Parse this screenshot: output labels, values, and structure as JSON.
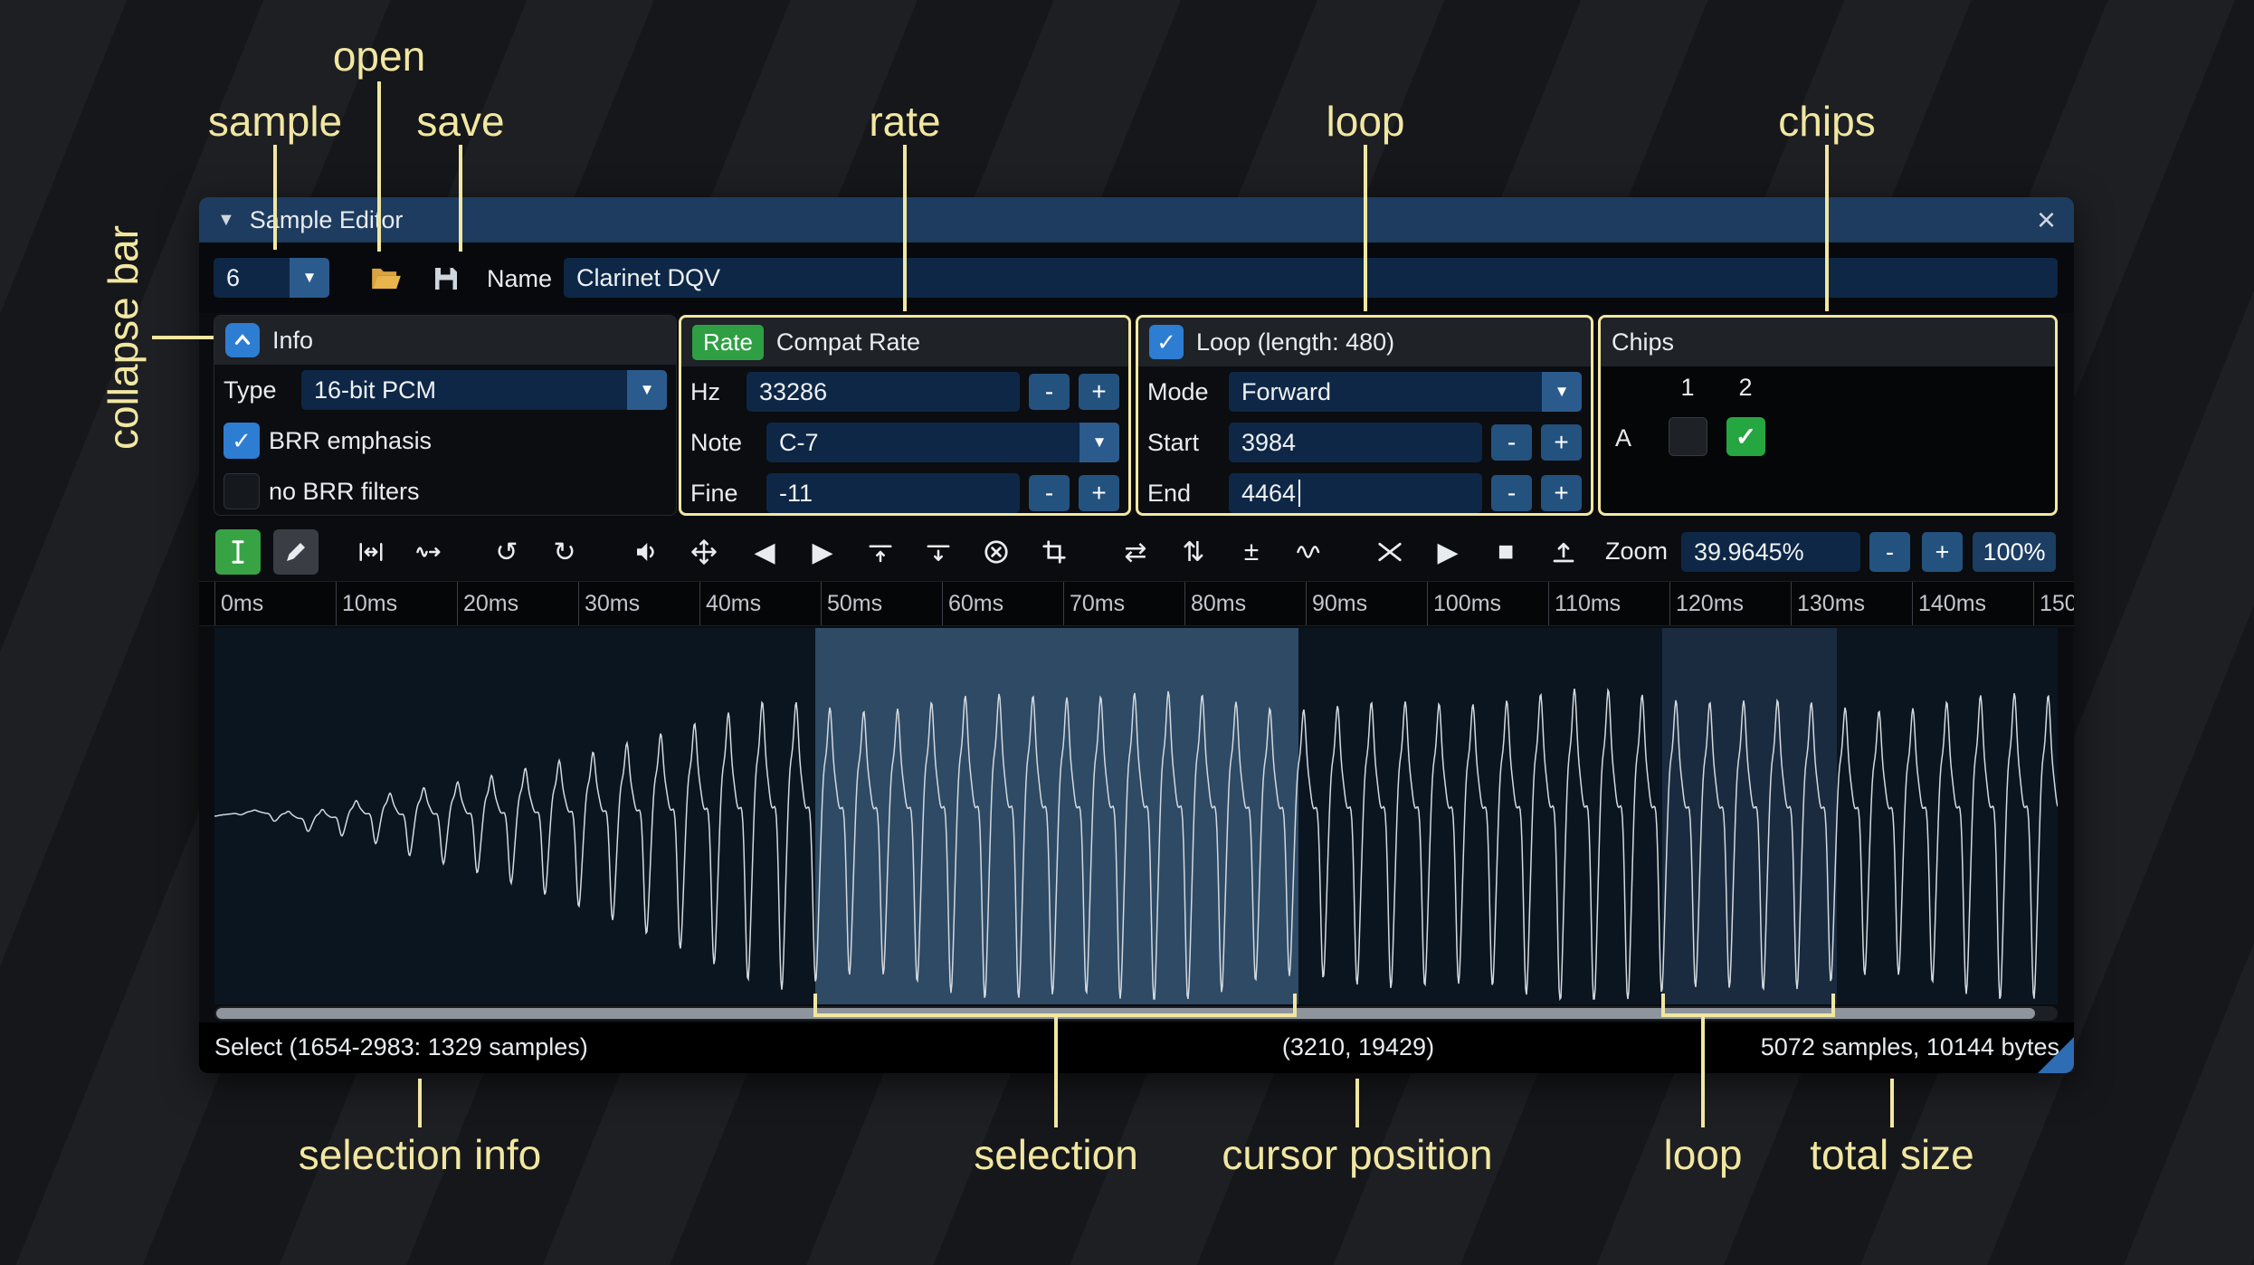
{
  "annotations": {
    "open": "open",
    "sample": "sample",
    "save": "save",
    "rate": "rate",
    "loop_top": "loop",
    "chips": "chips",
    "collapse_bar": "collapse bar",
    "selection_info": "selection info",
    "selection": "selection",
    "cursor_position": "cursor position",
    "loop_bottom": "loop",
    "total_size": "total size",
    "color": "#f1e7a1"
  },
  "titlebar": {
    "title": "Sample Editor"
  },
  "controls": {
    "sample_value": "6",
    "name_label": "Name",
    "name_value": "Clarinet DQV"
  },
  "info": {
    "header": "Info",
    "type_label": "Type",
    "type_value": "16-bit PCM",
    "brr_emphasis_label": "BRR emphasis",
    "no_brr_filters_label": "no BRR filters"
  },
  "rate": {
    "badge": "Rate",
    "header": "Compat Rate",
    "hz_label": "Hz",
    "hz_value": "33286",
    "note_label": "Note",
    "note_value": "C-7",
    "fine_label": "Fine",
    "fine_value": "-11"
  },
  "loop": {
    "header": "Loop (length: 480)",
    "mode_label": "Mode",
    "mode_value": "Forward",
    "start_label": "Start",
    "start_value": "3984",
    "end_label": "End",
    "end_value": "4464"
  },
  "chips": {
    "header": "Chips",
    "col_1": "1",
    "col_2": "2",
    "row_a": "A"
  },
  "toolbar": {
    "zoom_label": "Zoom",
    "zoom_value": "39.9645%",
    "zoom_out": "-",
    "zoom_in": "+",
    "zoom_reset": "100%"
  },
  "stepper": {
    "minus": "-",
    "plus": "+"
  },
  "icons": {
    "collapse_triangle": "▼",
    "close": "×",
    "dropdown": "▼",
    "checkbox_check": "✓",
    "undo": "↺",
    "redo": "↻",
    "fade_in": "◀",
    "fade_out": "▶",
    "reverse": "⇄",
    "invert": "⇅",
    "sign": "±",
    "preview": "▶",
    "stop": "■"
  },
  "ruler": [
    "0ms",
    "10ms",
    "20ms",
    "30ms",
    "40ms",
    "50ms",
    "60ms",
    "70ms",
    "80ms",
    "90ms",
    "100ms",
    "110ms",
    "120ms",
    "130ms",
    "140ms",
    "150"
  ],
  "status": {
    "selection": "Select (1654-2983: 1329 samples)",
    "cursor": "(3210, 19429)",
    "size": "5072 samples, 10144 bytes"
  }
}
